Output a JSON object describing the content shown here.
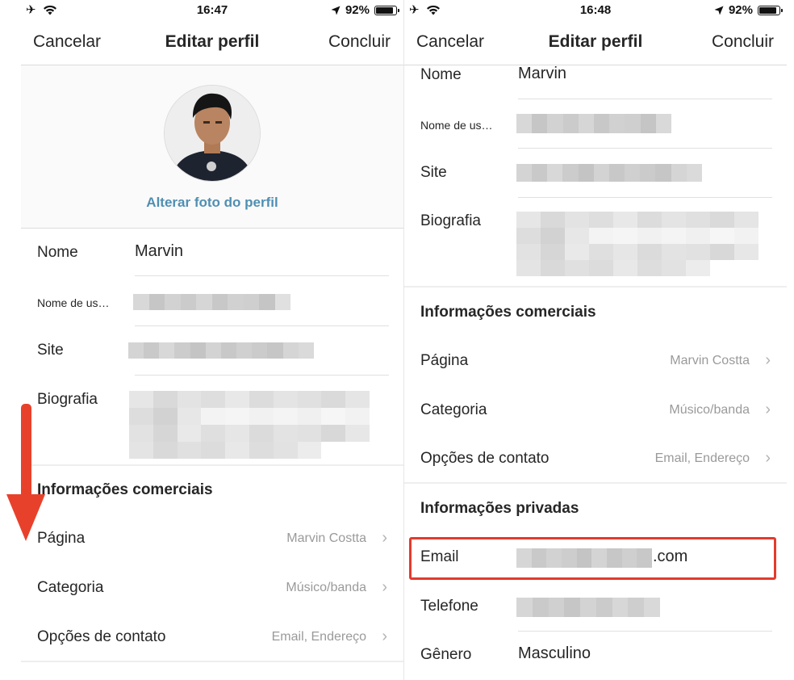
{
  "status_left": {
    "time": "16:47",
    "battery": "92%"
  },
  "status_right": {
    "time": "16:48",
    "battery": "92%"
  },
  "nav": {
    "cancel": "Cancelar",
    "title": "Editar perfil",
    "done": "Concluir"
  },
  "profile": {
    "change_photo": "Alterar foto do perfil"
  },
  "fields": {
    "name_label": "Nome",
    "name_value": "Marvin",
    "username_label": "Nome de us…",
    "site_label": "Site",
    "bio_label": "Biografia"
  },
  "business": {
    "title": "Informações comerciais",
    "page_label": "Página",
    "page_value": "Marvin Costta",
    "category_label": "Categoria",
    "category_value": "Músico/banda",
    "contact_label": "Opções de contato",
    "contact_value": "Email, Endereço"
  },
  "private": {
    "title": "Informações privadas",
    "email_label": "Email",
    "email_suffix": ".com",
    "phone_label": "Telefone",
    "gender_label": "Gênero",
    "gender_value": "Masculino"
  },
  "colors": {
    "accent_link": "#4f8fb3",
    "highlight": "#e33b2e",
    "arrow": "#e8412b"
  },
  "icons": [
    "airplane-icon",
    "wifi-icon",
    "location-arrow-icon",
    "battery-icon",
    "chevron-right-icon",
    "down-arrow-icon"
  ]
}
